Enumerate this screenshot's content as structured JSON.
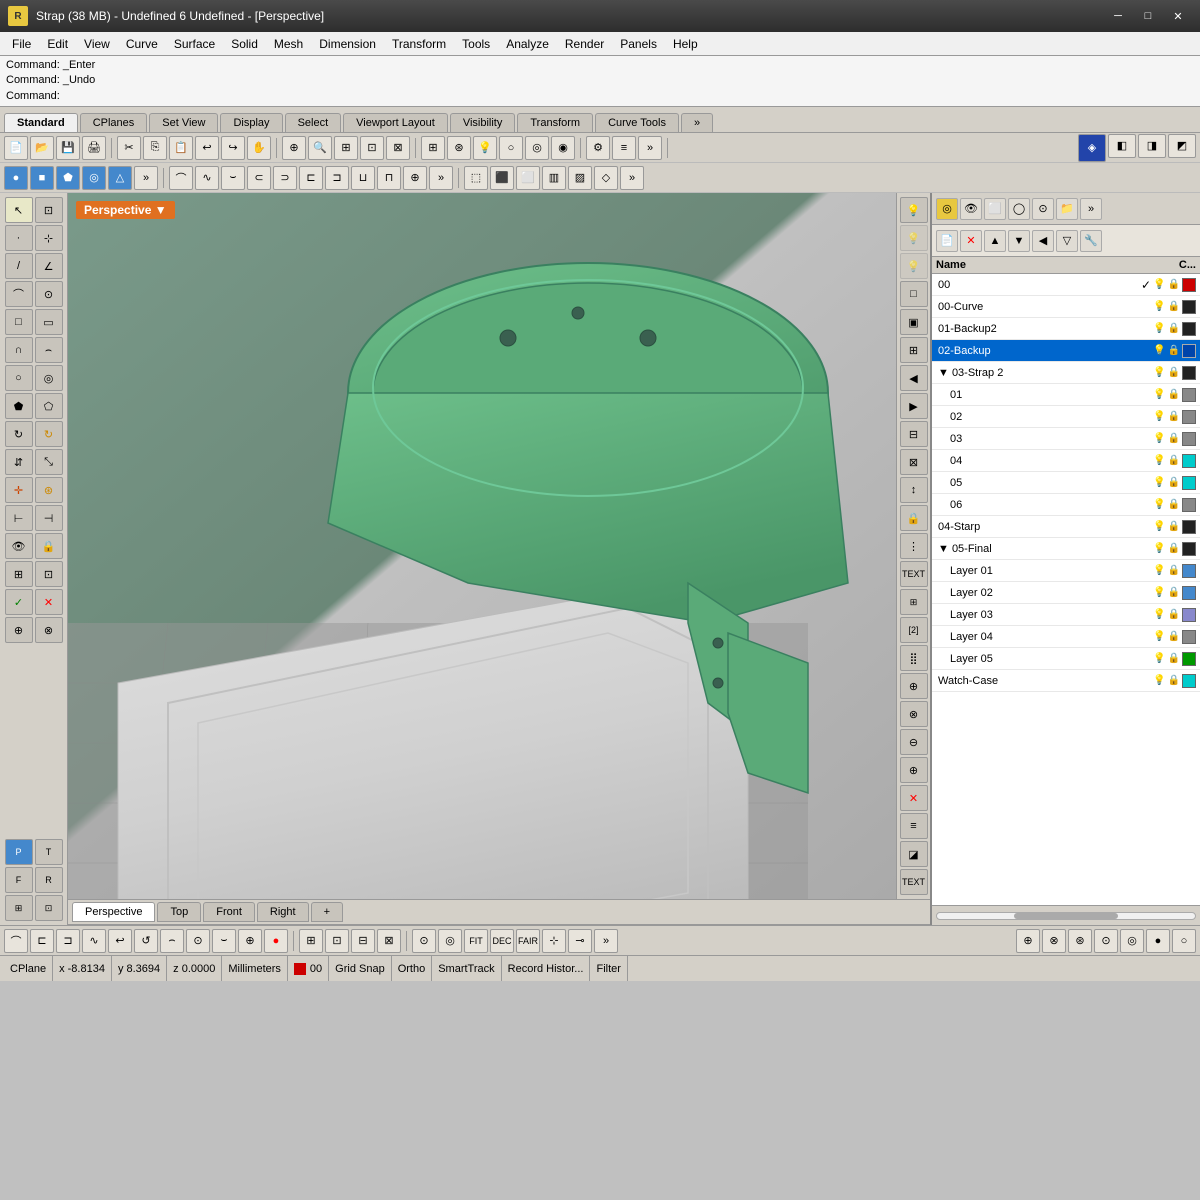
{
  "titlebar": {
    "title": "Strap (38 MB) - Undefined 6 Undefined - [Perspective]",
    "icon_label": "R",
    "minimize": "─",
    "maximize": "□",
    "close": "✕"
  },
  "menubar": {
    "items": [
      "File",
      "Edit",
      "View",
      "Curve",
      "Surface",
      "Solid",
      "Mesh",
      "Dimension",
      "Transform",
      "Tools",
      "Analyze",
      "Render",
      "Panels",
      "Help"
    ]
  },
  "commandbar": {
    "line1": "Command: _Enter",
    "line2": "Command: _Undo",
    "line3": "Command:",
    "placeholder": ""
  },
  "toolbar_tabs": {
    "tabs": [
      "Standard",
      "CPlanes",
      "Set View",
      "Display",
      "Select",
      "Viewport Layout",
      "Visibility",
      "Transform",
      "Curve Tools"
    ]
  },
  "viewport": {
    "label": "Perspective",
    "label_arrow": "▼"
  },
  "tabs": {
    "items": [
      "Perspective",
      "Top",
      "Front",
      "Right",
      "+"
    ]
  },
  "layers": {
    "header_name": "Name",
    "header_c": "C...",
    "rows": [
      {
        "name": "00",
        "indent": 0,
        "check": "✓",
        "selected": false,
        "color": "#cc0000"
      },
      {
        "name": "00-Curve",
        "indent": 0,
        "check": "",
        "selected": false,
        "color": "#222222"
      },
      {
        "name": "01-Backup2",
        "indent": 0,
        "check": "",
        "selected": false,
        "color": "#222222"
      },
      {
        "name": "02-Backup",
        "indent": 0,
        "check": "",
        "selected": true,
        "color": "#0044aa"
      },
      {
        "name": "03-Strap 2",
        "indent": 0,
        "check": "",
        "selected": false,
        "color": "#222222",
        "collapsed": false
      },
      {
        "name": "01",
        "indent": 1,
        "check": "",
        "selected": false,
        "color": "#888888"
      },
      {
        "name": "02",
        "indent": 1,
        "check": "",
        "selected": false,
        "color": "#888888"
      },
      {
        "name": "03",
        "indent": 1,
        "check": "",
        "selected": false,
        "color": "#888888"
      },
      {
        "name": "04",
        "indent": 1,
        "check": "",
        "selected": false,
        "color": "#00cccc"
      },
      {
        "name": "05",
        "indent": 1,
        "check": "",
        "selected": false,
        "color": "#00cccc"
      },
      {
        "name": "06",
        "indent": 1,
        "check": "",
        "selected": false,
        "color": "#888888"
      },
      {
        "name": "04-Starp",
        "indent": 0,
        "check": "",
        "selected": false,
        "color": "#222222"
      },
      {
        "name": "05-Final",
        "indent": 0,
        "check": "",
        "selected": false,
        "color": "#222222",
        "collapsed": false
      },
      {
        "name": "Layer 01",
        "indent": 1,
        "check": "",
        "selected": false,
        "color": "#4488cc"
      },
      {
        "name": "Layer 02",
        "indent": 1,
        "check": "",
        "selected": false,
        "color": "#4488cc"
      },
      {
        "name": "Layer 03",
        "indent": 1,
        "check": "",
        "selected": false,
        "color": "#8888cc"
      },
      {
        "name": "Layer 04",
        "indent": 1,
        "check": "",
        "selected": false,
        "color": "#888888"
      },
      {
        "name": "Layer 05",
        "indent": 1,
        "check": "",
        "selected": false,
        "color": "#009900"
      },
      {
        "name": "Watch-Case",
        "indent": 0,
        "check": "",
        "selected": false,
        "color": "#00cccc"
      }
    ]
  },
  "statusbar": {
    "cplane": "CPlane",
    "x": "x  -8.8134",
    "y": "y  8.3694",
    "z": "z  0.0000",
    "units": "Millimeters",
    "layer": "00",
    "grid": "Grid Snap",
    "ortho": "Ortho",
    "snap": "SmartTrack",
    "record": "Record Histor...",
    "filter": "Filter"
  },
  "small_viewports": [
    {
      "label": "Perspective"
    },
    {
      "label": "Top"
    },
    {
      "label": "Right"
    }
  ],
  "bottom_status": {
    "ortho": "Ortho"
  }
}
